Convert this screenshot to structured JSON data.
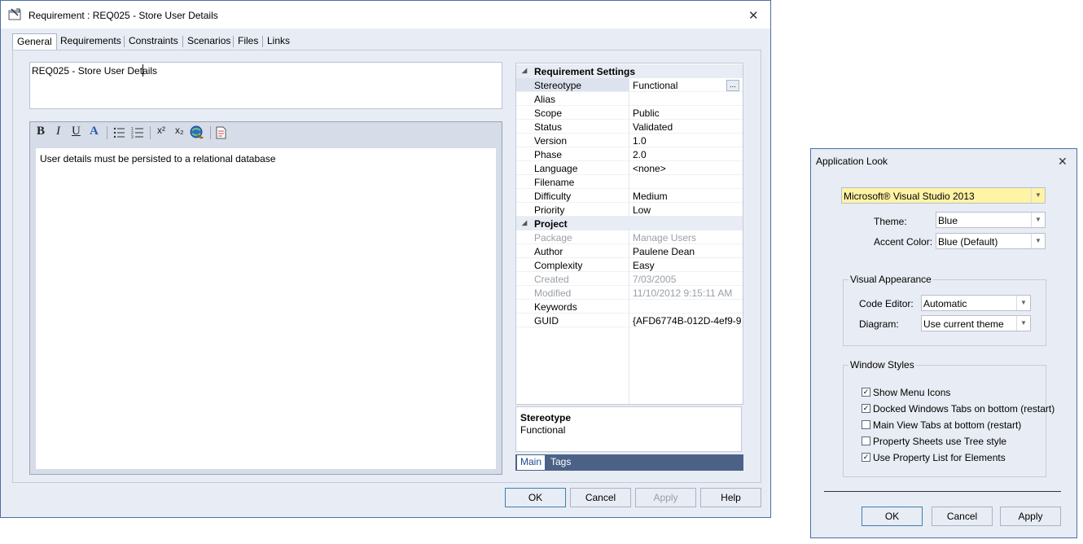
{
  "req_dialog": {
    "title": "Requirement : REQ025 - Store User Details",
    "tabs": [
      "General",
      "Requirements",
      "Constraints",
      "Scenarios",
      "Files",
      "Links"
    ],
    "name_value": "REQ025 - Store User Details",
    "notes_text": "User details must be persisted to a relational database",
    "toolbar": {
      "bold": "B",
      "italic": "I",
      "underline": "U",
      "font_color": "A",
      "superscript": "x²",
      "subscript": "x₂"
    },
    "properties": {
      "section1": "Requirement Settings",
      "rows1": [
        {
          "name": "Stereotype",
          "value": "Functional"
        },
        {
          "name": "Alias",
          "value": ""
        },
        {
          "name": "Scope",
          "value": "Public"
        },
        {
          "name": "Status",
          "value": "Validated"
        },
        {
          "name": "Version",
          "value": "1.0"
        },
        {
          "name": "Phase",
          "value": "2.0"
        },
        {
          "name": "Language",
          "value": "<none>"
        },
        {
          "name": "Filename",
          "value": ""
        },
        {
          "name": "Difficulty",
          "value": "Medium"
        },
        {
          "name": "Priority",
          "value": "Low"
        }
      ],
      "section2": "Project",
      "rows2": [
        {
          "name": "Package",
          "value": "Manage Users",
          "muted": true
        },
        {
          "name": "Author",
          "value": "Paulene Dean",
          "muted": false
        },
        {
          "name": "Complexity",
          "value": "Easy",
          "muted": false
        },
        {
          "name": "Created",
          "value": "7/03/2005",
          "muted": true
        },
        {
          "name": "Modified",
          "value": "11/10/2012 9:15:11 AM",
          "muted": true
        },
        {
          "name": "Keywords",
          "value": "",
          "muted": false
        },
        {
          "name": "GUID",
          "value": "{AFD6774B-012D-4ef9-9...",
          "muted": false
        }
      ],
      "ellipsis_label": "..."
    },
    "description": {
      "title": "Stereotype",
      "text": "Functional"
    },
    "bottom_tabs": [
      "Main",
      "Tags"
    ],
    "buttons": {
      "ok": "OK",
      "cancel": "Cancel",
      "apply": "Apply",
      "help": "Help"
    }
  },
  "look_dialog": {
    "title": "Application Look",
    "style_combo": "Microsoft® Visual Studio 2013",
    "theme_label": "Theme:",
    "theme_value": "Blue",
    "accent_label": "Accent Color:",
    "accent_value": "Blue (Default)",
    "visual_group": "Visual Appearance",
    "code_editor_label": "Code Editor:",
    "code_editor_value": "Automatic",
    "diagram_label": "Diagram:",
    "diagram_value": "Use current theme",
    "window_group": "Window Styles",
    "checkboxes": [
      {
        "label": "Show Menu Icons",
        "checked": true
      },
      {
        "label": "Docked Windows Tabs on bottom (restart)",
        "checked": true
      },
      {
        "label": "Main View Tabs at bottom (restart)",
        "checked": false
      },
      {
        "label": "Property Sheets use Tree style",
        "checked": false
      },
      {
        "label": "Use Property List for Elements",
        "checked": true
      }
    ],
    "buttons": {
      "ok": "OK",
      "cancel": "Cancel",
      "apply": "Apply"
    }
  },
  "colors": {
    "accent": "#4c6186",
    "highlight_yellow": "#fff3a6",
    "dialog_bg": "#e8ecf4"
  }
}
